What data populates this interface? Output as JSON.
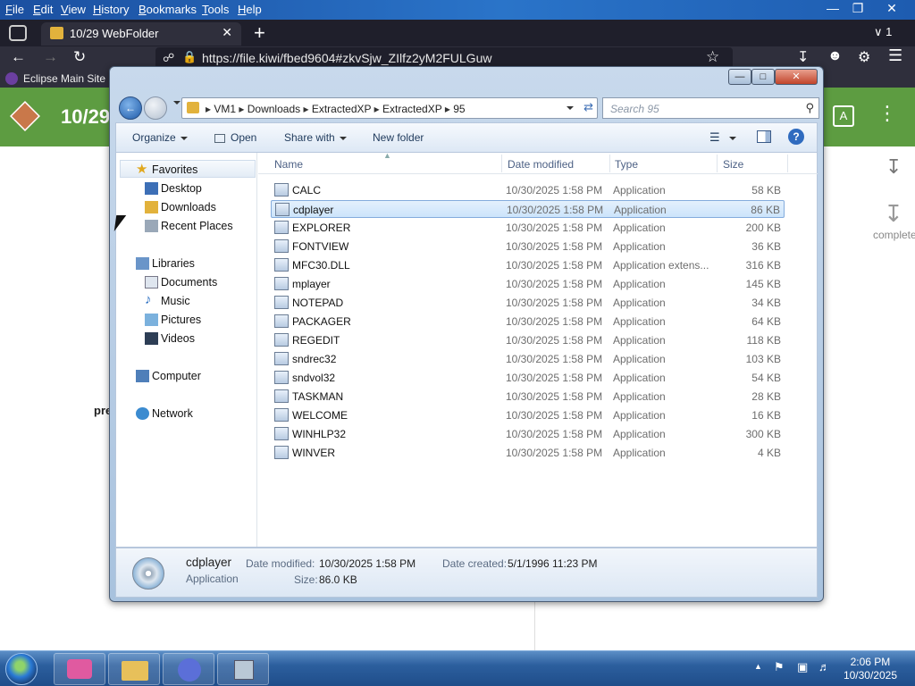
{
  "browser": {
    "menu": [
      "File",
      "Edit",
      "View",
      "History",
      "Bookmarks",
      "Tools",
      "Help"
    ],
    "tab_title": "10/29 WebFolder",
    "tab_count": "1",
    "url": "https://file.kiwi/fbed9604#zkvSjw_ZIlfz2yM2FULGuw",
    "bookmark": "Eclipse Main Site",
    "page_title": "10/29",
    "page_partial_text": "pre",
    "download_status": "complete"
  },
  "explorer": {
    "breadcrumb": [
      "VM1",
      "Downloads",
      "ExtractedXP",
      "ExtractedXP",
      "95"
    ],
    "search_placeholder": "Search 95",
    "toolbar": {
      "organize": "Organize",
      "open": "Open",
      "share": "Share with",
      "new_folder": "New folder"
    },
    "nav": {
      "favorites": "Favorites",
      "desktop": "Desktop",
      "downloads": "Downloads",
      "recent": "Recent Places",
      "libraries": "Libraries",
      "documents": "Documents",
      "music": "Music",
      "pictures": "Pictures",
      "videos": "Videos",
      "computer": "Computer",
      "network": "Network"
    },
    "columns": {
      "name": "Name",
      "date": "Date modified",
      "type": "Type",
      "size": "Size"
    },
    "files": [
      {
        "name": "CALC",
        "date": "10/30/2025 1:58 PM",
        "type": "Application",
        "size": "58 KB"
      },
      {
        "name": "cdplayer",
        "date": "10/30/2025 1:58 PM",
        "type": "Application",
        "size": "86 KB"
      },
      {
        "name": "EXPLORER",
        "date": "10/30/2025 1:58 PM",
        "type": "Application",
        "size": "200 KB"
      },
      {
        "name": "FONTVIEW",
        "date": "10/30/2025 1:58 PM",
        "type": "Application",
        "size": "36 KB"
      },
      {
        "name": "MFC30.DLL",
        "date": "10/30/2025 1:58 PM",
        "type": "Application extens...",
        "size": "316 KB"
      },
      {
        "name": "mplayer",
        "date": "10/30/2025 1:58 PM",
        "type": "Application",
        "size": "145 KB"
      },
      {
        "name": "NOTEPAD",
        "date": "10/30/2025 1:58 PM",
        "type": "Application",
        "size": "34 KB"
      },
      {
        "name": "PACKAGER",
        "date": "10/30/2025 1:58 PM",
        "type": "Application",
        "size": "64 KB"
      },
      {
        "name": "REGEDIT",
        "date": "10/30/2025 1:58 PM",
        "type": "Application",
        "size": "118 KB"
      },
      {
        "name": "sndrec32",
        "date": "10/30/2025 1:58 PM",
        "type": "Application",
        "size": "103 KB"
      },
      {
        "name": "sndvol32",
        "date": "10/30/2025 1:58 PM",
        "type": "Application",
        "size": "54 KB"
      },
      {
        "name": "TASKMAN",
        "date": "10/30/2025 1:58 PM",
        "type": "Application",
        "size": "28 KB"
      },
      {
        "name": "WELCOME",
        "date": "10/30/2025 1:58 PM",
        "type": "Application",
        "size": "16 KB"
      },
      {
        "name": "WINHLP32",
        "date": "10/30/2025 1:58 PM",
        "type": "Application",
        "size": "300 KB"
      },
      {
        "name": "WINVER",
        "date": "10/30/2025 1:58 PM",
        "type": "Application",
        "size": "4 KB"
      }
    ],
    "selected_index": 1,
    "details": {
      "name": "cdplayer",
      "kind": "Application",
      "modified_label": "Date modified:",
      "modified_value": "10/30/2025 1:58 PM",
      "created_label": "Date created:",
      "created_value": "5/1/1996 11:23 PM",
      "size_label": "Size:",
      "size_value": "86.0 KB"
    }
  },
  "taskbar": {
    "time": "2:06 PM",
    "date": "10/30/2025"
  },
  "colors": {
    "header_green": "#5d9c41",
    "selection_blue": "#cce4fb",
    "taskbar_blue": "#2c5f9e"
  }
}
